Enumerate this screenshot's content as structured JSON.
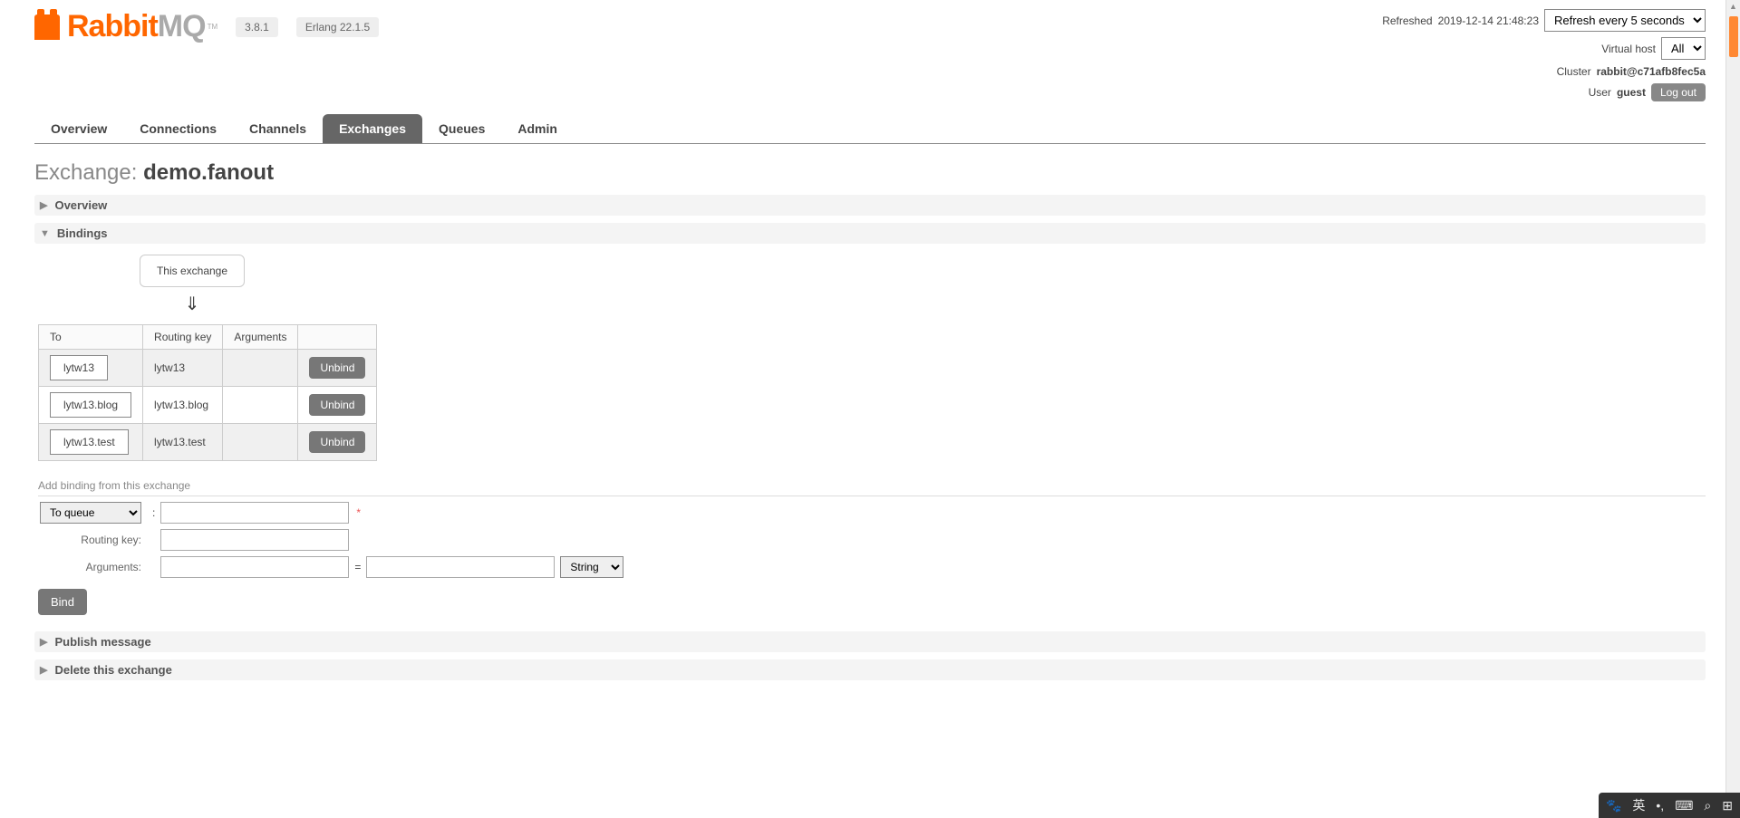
{
  "header": {
    "logo_orange": "Rabbit",
    "logo_grey": "MQ",
    "version": "3.8.1",
    "erlang": "Erlang 22.1.5",
    "refreshed_label": "Refreshed",
    "refreshed_time": "2019-12-14 21:48:23",
    "refresh_select": "Refresh every 5 seconds",
    "vhost_label": "Virtual host",
    "vhost_value": "All",
    "cluster_label": "Cluster",
    "cluster_value": "rabbit@c71afb8fec5a",
    "user_label": "User",
    "user_value": "guest",
    "logout": "Log out"
  },
  "nav": {
    "overview": "Overview",
    "connections": "Connections",
    "channels": "Channels",
    "exchanges": "Exchanges",
    "queues": "Queues",
    "admin": "Admin"
  },
  "title_prefix": "Exchange:",
  "title_name": "demo.fanout",
  "sections": {
    "overview": "Overview",
    "bindings": "Bindings",
    "publish": "Publish message",
    "delete": "Delete this exchange"
  },
  "bindings": {
    "this_exchange": "This exchange",
    "arrow": "⇓",
    "headers": {
      "to": "To",
      "routing": "Routing key",
      "args": "Arguments"
    },
    "rows": [
      {
        "to": "lytw13",
        "routing": "lytw13",
        "args": "",
        "unbind": "Unbind"
      },
      {
        "to": "lytw13.blog",
        "routing": "lytw13.blog",
        "args": "",
        "unbind": "Unbind"
      },
      {
        "to": "lytw13.test",
        "routing": "lytw13.test",
        "args": "",
        "unbind": "Unbind"
      }
    ]
  },
  "add_binding": {
    "heading": "Add binding from this exchange",
    "target_select": "To queue",
    "routing_label": "Routing key:",
    "args_label": "Arguments:",
    "type_select": "String",
    "bind_button": "Bind"
  }
}
